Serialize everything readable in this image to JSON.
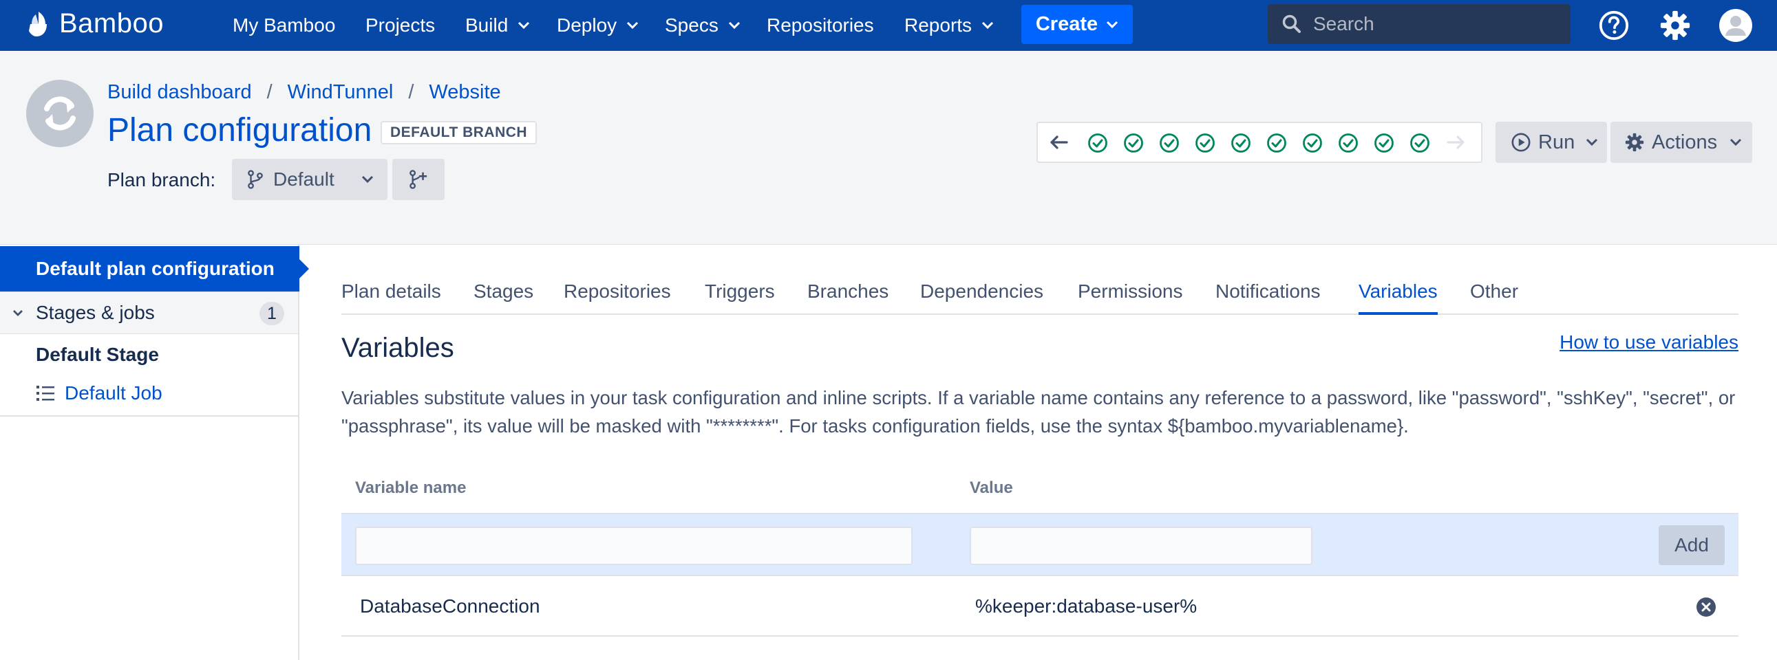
{
  "app": {
    "name": "Bamboo"
  },
  "nav": {
    "items": [
      {
        "label": "My Bamboo",
        "dropdown": false
      },
      {
        "label": "Projects",
        "dropdown": false
      },
      {
        "label": "Build",
        "dropdown": true
      },
      {
        "label": "Deploy",
        "dropdown": true
      },
      {
        "label": "Specs",
        "dropdown": true
      },
      {
        "label": "Repositories",
        "dropdown": false
      },
      {
        "label": "Reports",
        "dropdown": true
      }
    ],
    "create_label": "Create",
    "search_placeholder": "Search",
    "icons": [
      "help-icon",
      "gear-icon",
      "user-avatar"
    ]
  },
  "header": {
    "breadcrumb": [
      "Build dashboard",
      "WindTunnel",
      "Website"
    ],
    "title": "Plan configuration",
    "lozenge": "DEFAULT BRANCH",
    "branch_label": "Plan branch:",
    "branch_value": "Default",
    "build_history": {
      "successful_builds": 10,
      "icons": [
        "arrow-left-icon",
        "check-circle-icon",
        "arrow-right-icon"
      ]
    },
    "run_label": "Run",
    "actions_label": "Actions"
  },
  "sidebar": {
    "active": "Default plan configuration",
    "stages_label": "Stages & jobs",
    "stages_count": "1",
    "stage": "Default Stage",
    "job": "Default Job"
  },
  "tabs": [
    {
      "label": "Plan details",
      "active": false
    },
    {
      "label": "Stages",
      "active": false
    },
    {
      "label": "Repositories",
      "active": false
    },
    {
      "label": "Triggers",
      "active": false
    },
    {
      "label": "Branches",
      "active": false
    },
    {
      "label": "Dependencies",
      "active": false
    },
    {
      "label": "Permissions",
      "active": false
    },
    {
      "label": "Notifications",
      "active": false
    },
    {
      "label": "Variables",
      "active": true
    },
    {
      "label": "Other",
      "active": false
    }
  ],
  "variables": {
    "title": "Variables",
    "help_link": "How to use variables",
    "description": "Variables substitute values in your task configuration and inline scripts. If a variable name contains any reference to a password, like \"password\", \"sshKey\", \"secret\", or \"passphrase\", its value will be masked with \"********\". For tasks configuration fields, use the syntax ${bamboo.myvariablename}.",
    "columns": [
      "Variable name",
      "Value"
    ],
    "new_name_value": "",
    "new_value_value": "",
    "add_label": "Add",
    "rows": [
      {
        "name": "DatabaseConnection",
        "value": "%keeper:database-user%"
      }
    ]
  },
  "colors": {
    "nav_bg": "#0747a6",
    "primary": "#0052cc",
    "create_bg": "#0065ff",
    "success": "#00875a",
    "header_bg": "#f4f5f7",
    "add_row_bg": "#deebff"
  }
}
